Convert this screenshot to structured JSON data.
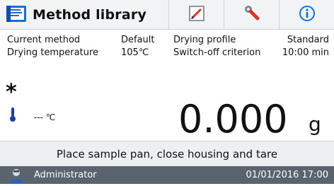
{
  "header": {
    "title": "Method library",
    "icons": {
      "library": "book-icon",
      "edit": "pencil-icon",
      "settings": "wrench-icon",
      "info": "info-icon"
    }
  },
  "method_info": {
    "current_method_label": "Current method",
    "current_method_value": "Default",
    "drying_profile_label": "Drying profile",
    "drying_profile_value": "Standard",
    "drying_temperature_label": "Drying temperature",
    "drying_temperature_value": "105℃",
    "switch_off_label": "Switch-off criterion",
    "switch_off_value": "10:00 min"
  },
  "status": {
    "asterisk": "*",
    "temperature_reading": "--- ℃",
    "weight_value": "0.000",
    "weight_unit": "g"
  },
  "prompt": {
    "message": "Place sample pan, close housing and tare"
  },
  "footer": {
    "user": "Administrator",
    "datetime": "01/01/2016 17:00"
  },
  "colors": {
    "accent_blue": "#1a6fd1",
    "edit_red": "#d9342b",
    "footer_bg": "#5a646e",
    "header_bg": "#f2f3f5"
  }
}
